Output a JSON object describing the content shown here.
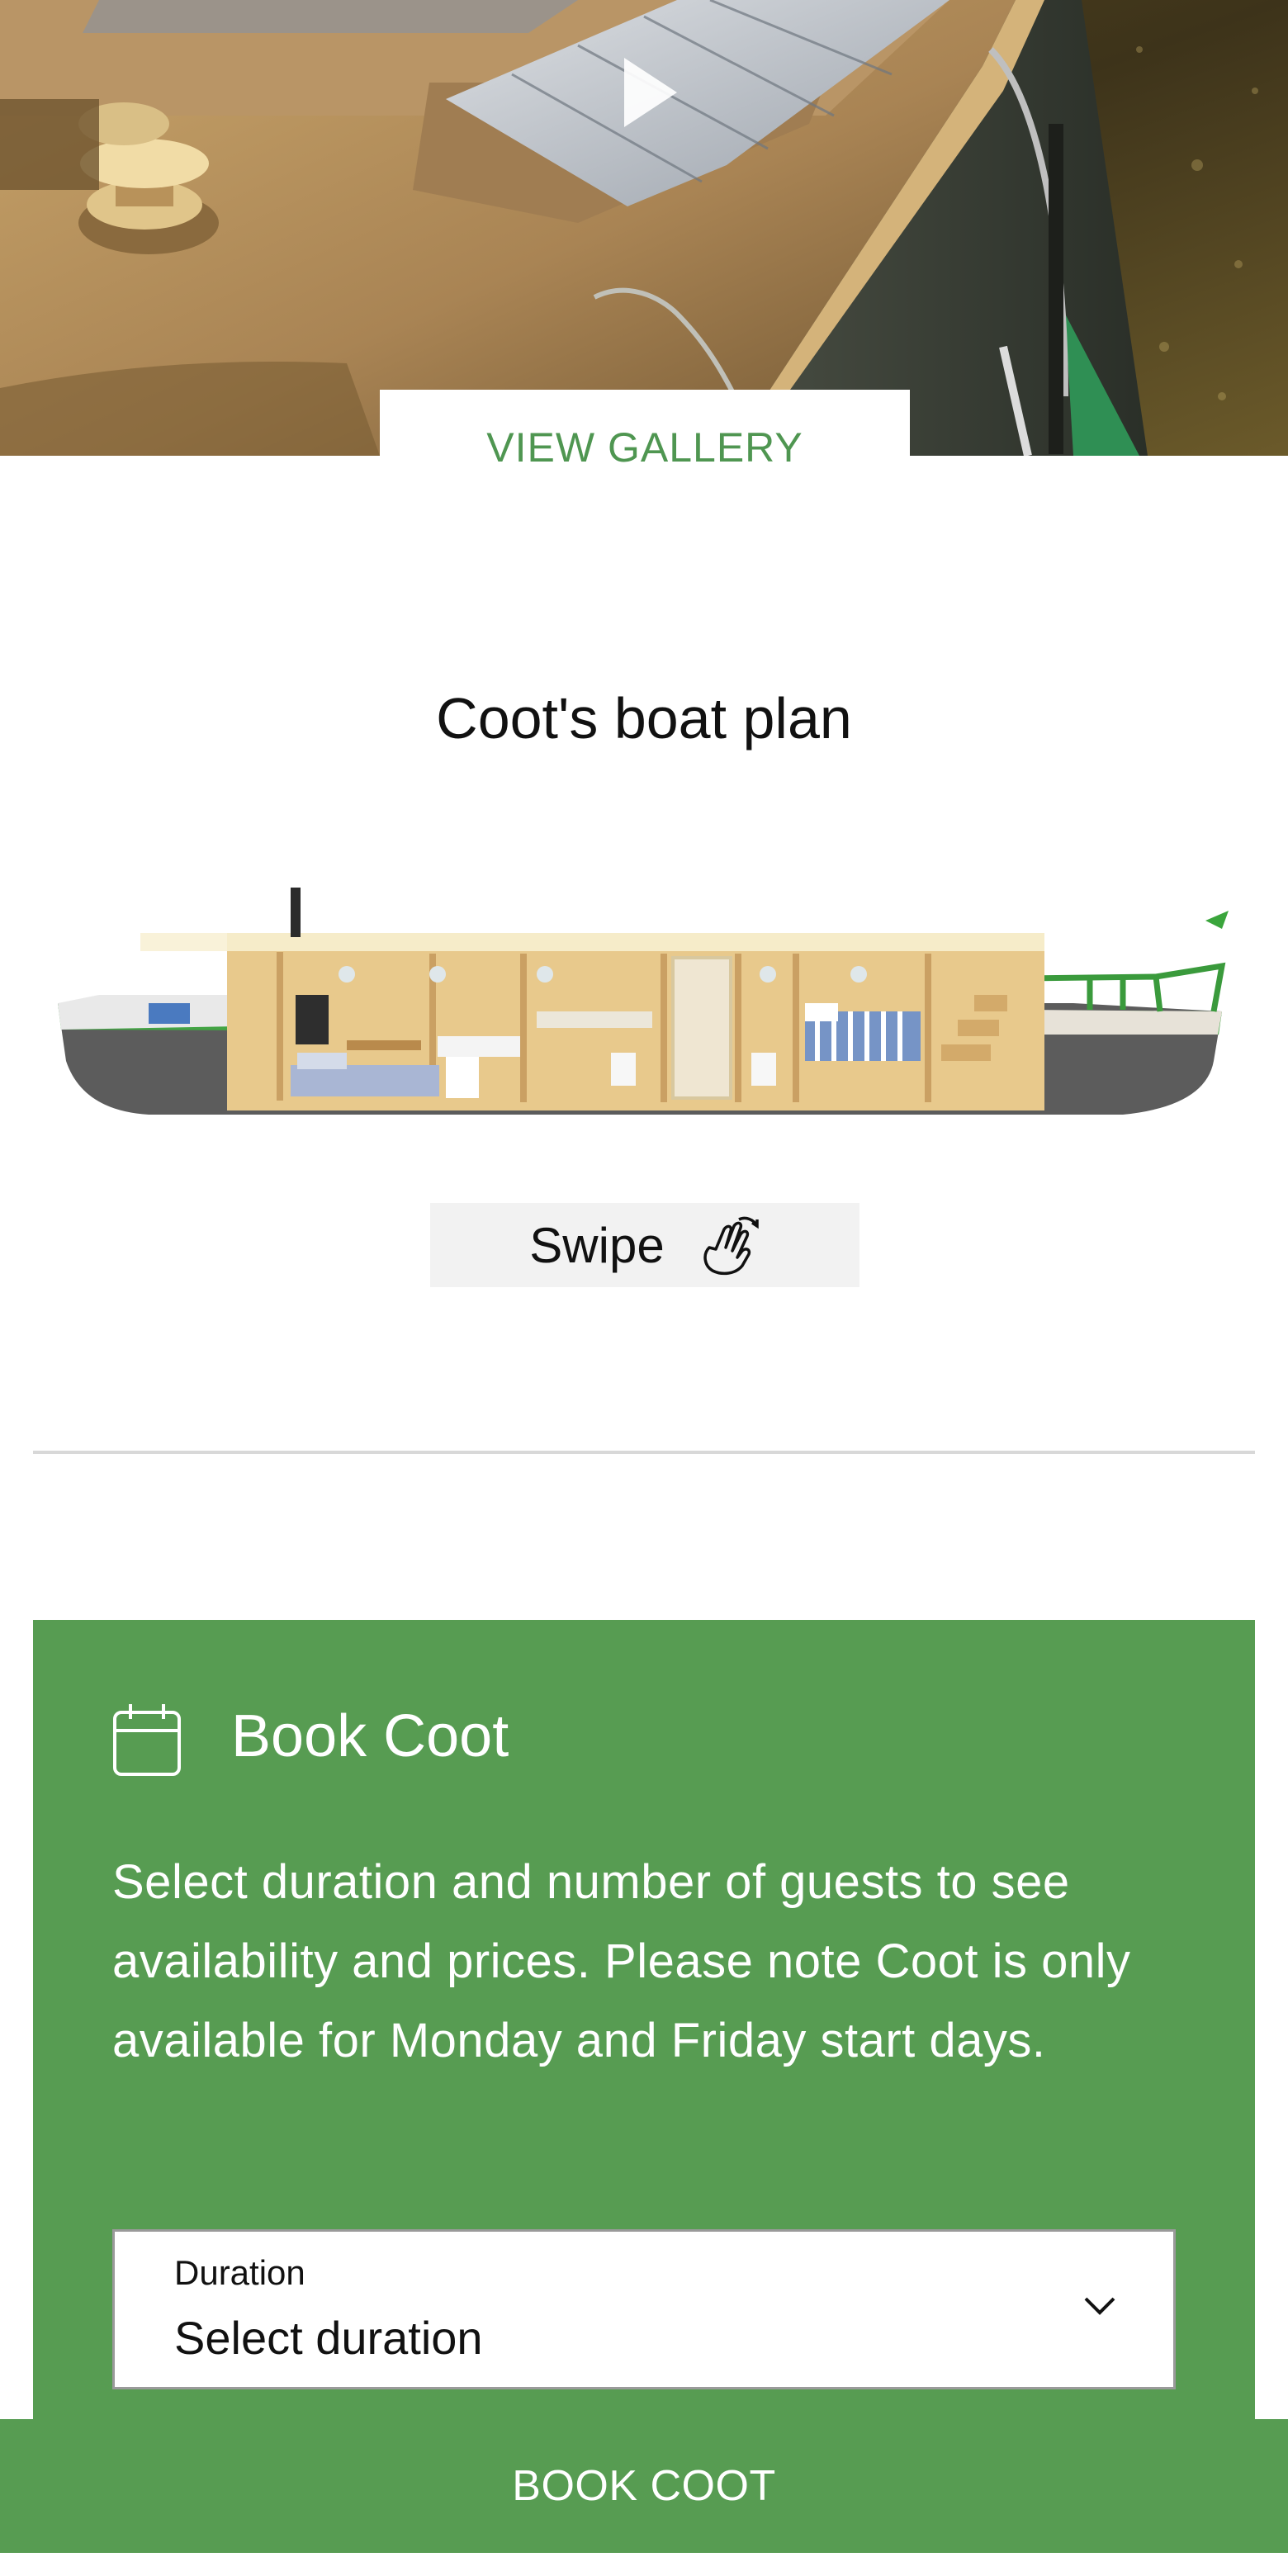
{
  "hero": {
    "gallery_label": "VIEW GALLERY",
    "play_icon": "play-icon"
  },
  "plan": {
    "title": "Coot's boat plan",
    "swipe_label": "Swipe",
    "swipe_icon": "swipe-hand-icon"
  },
  "booking": {
    "icon": "calendar-icon",
    "title": "Book Coot",
    "description": "Select duration and number of guests to see availability and prices. Please note Coot is only available for Monday and Friday start days.",
    "duration_label": "Duration",
    "duration_value": "Select duration",
    "chevron_icon": "chevron-down-icon"
  },
  "cta": {
    "label": "BOOK COOT"
  },
  "colors": {
    "brand_green": "#579c52",
    "link_green": "#4f9651",
    "swipe_bg": "#f2f2f2",
    "divider": "#d8d8d8"
  }
}
